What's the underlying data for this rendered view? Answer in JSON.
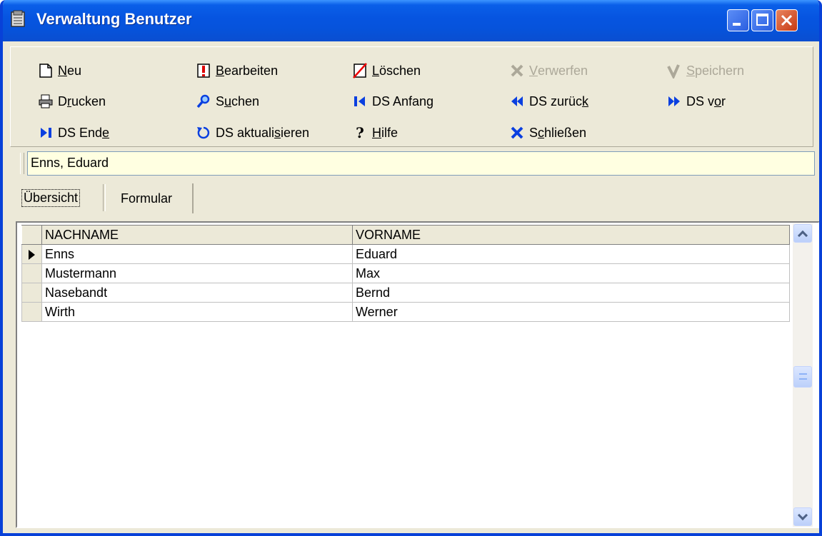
{
  "window": {
    "title": "Verwaltung Benutzer"
  },
  "toolbar": {
    "new": {
      "label": "Neu",
      "ul": "N",
      "rest": "eu"
    },
    "edit": {
      "ul": "B",
      "rest": "earbeiten"
    },
    "delete": {
      "ul": "L",
      "rest": "öschen"
    },
    "discard": {
      "ul": "V",
      "rest": "erwerfen"
    },
    "save": {
      "ul": "S",
      "rest": "peichern"
    },
    "print": {
      "pre": "D",
      "ul": "r",
      "rest": "ucken"
    },
    "search": {
      "pre": "S",
      "ul": "u",
      "rest": "chen"
    },
    "first": {
      "label": "DS Anfang"
    },
    "prev": {
      "pre": "DS zurüc",
      "ul": "k",
      "rest": ""
    },
    "next": {
      "pre": "DS v",
      "ul": "o",
      "rest": "r"
    },
    "last": {
      "pre": "DS End",
      "ul": "e",
      "rest": ""
    },
    "refresh": {
      "pre": "DS aktuali",
      "ul": "s",
      "rest": "ieren"
    },
    "help": {
      "ul": "H",
      "rest": "ilfe"
    },
    "close": {
      "pre": "S",
      "ul": "c",
      "rest": "hließen"
    }
  },
  "record_display": "Enns, Eduard",
  "tabs": [
    {
      "label": "Übersicht"
    },
    {
      "label": "Formular"
    }
  ],
  "table": {
    "columns": [
      "NACHNAME",
      "VORNAME"
    ],
    "rows": [
      {
        "nachname": "Enns",
        "vorname": "Eduard"
      },
      {
        "nachname": "Mustermann",
        "vorname": "Max"
      },
      {
        "nachname": "Nasebandt",
        "vorname": "Bernd"
      },
      {
        "nachname": "Wirth",
        "vorname": "Werner"
      }
    ]
  },
  "icons": {
    "title": "app-window-icon",
    "new": "new-document-icon",
    "edit": "edit-icon",
    "delete": "delete-icon",
    "discard": "discard-x-icon",
    "save": "checkmark-icon",
    "print": "printer-icon",
    "search": "magnifier-icon",
    "first": "first-record-icon",
    "prev": "previous-record-icon",
    "next": "next-record-icon",
    "last": "last-record-icon",
    "refresh": "refresh-icon",
    "help": "question-mark-icon",
    "close": "close-x-icon"
  },
  "colors": {
    "titlebar": "#0654E0",
    "face": "#ECE9D8",
    "record_bg": "#FFFFE1",
    "nav_icon": "#0A3FE0"
  }
}
